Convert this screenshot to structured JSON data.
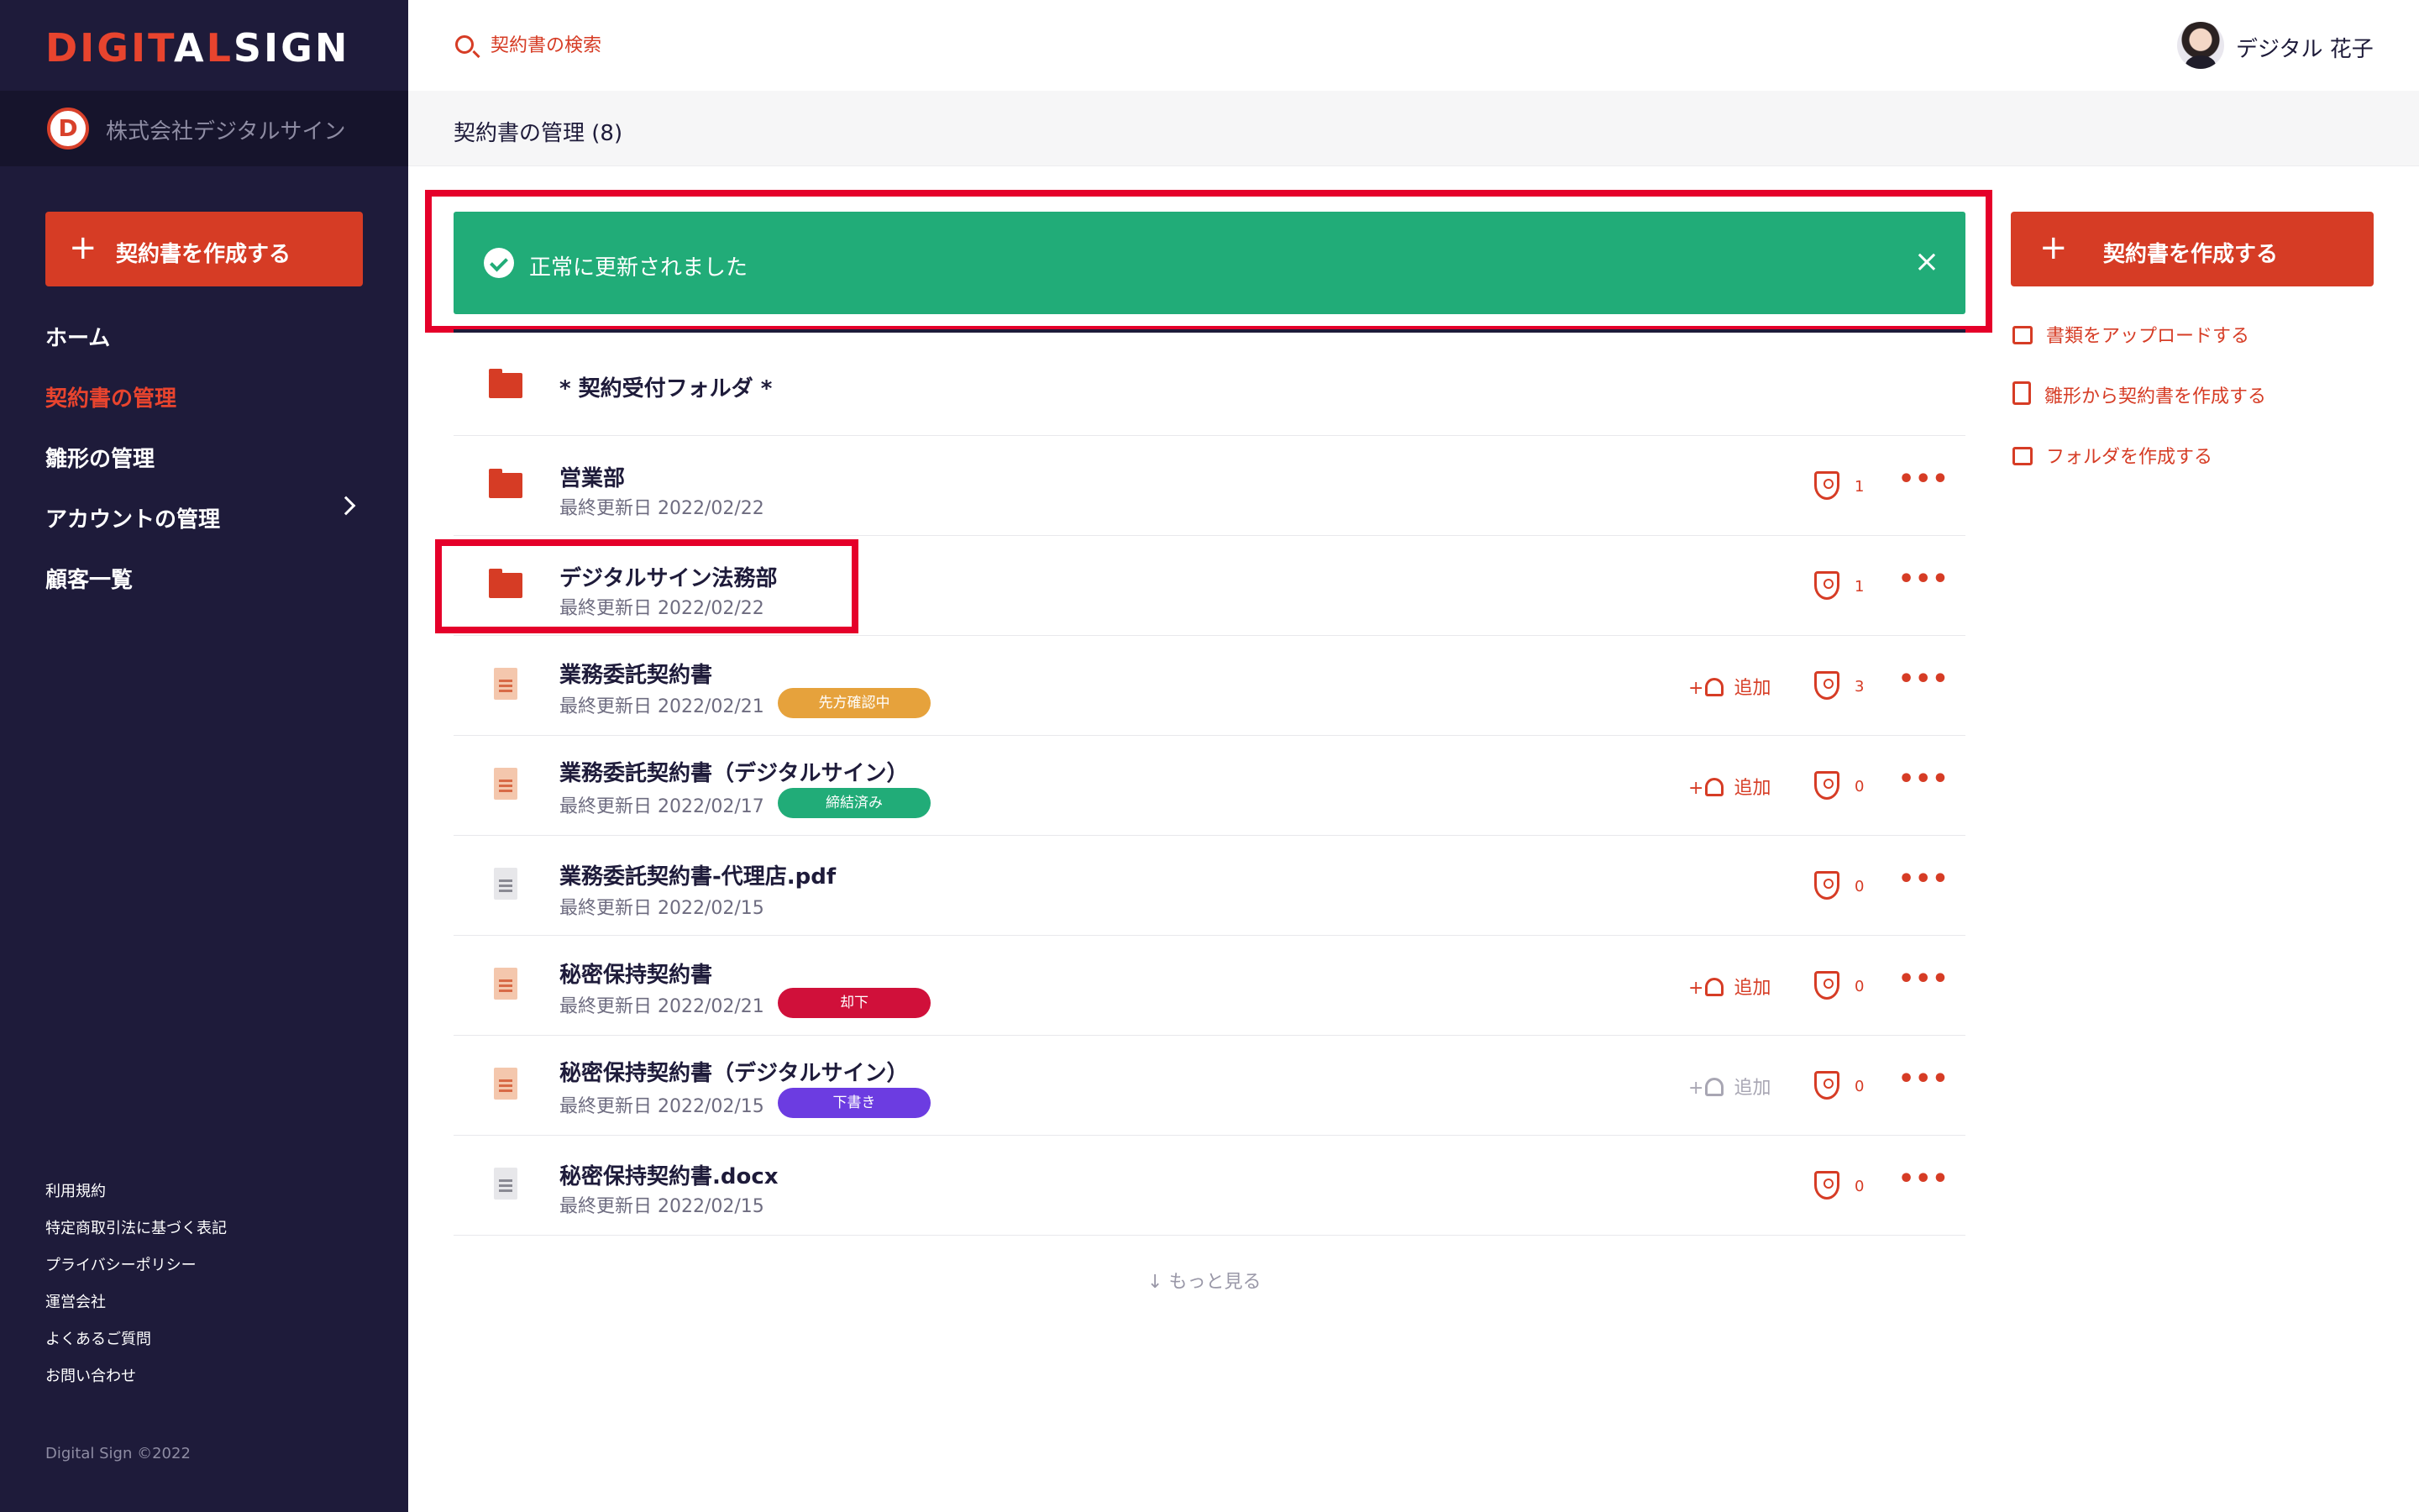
{
  "brand": {
    "logo_part1": "DIGIT",
    "logo_a": "A",
    "logo_part2": "L",
    "logo_part3": "SIGN",
    "accent_color": "#d63c25"
  },
  "company": {
    "badge": "D",
    "name": "株式会社デジタルサイン"
  },
  "sidebar": {
    "create_label": "契約書を作成する",
    "nav": [
      {
        "label": "ホーム"
      },
      {
        "label": "契約書の管理"
      },
      {
        "label": "雛形の管理"
      },
      {
        "label": "アカウントの管理"
      },
      {
        "label": "顧客一覧"
      }
    ],
    "footer_links": [
      {
        "label": "利用規約"
      },
      {
        "label": "特定商取引法に基づく表記"
      },
      {
        "label": "プライバシーポリシー"
      },
      {
        "label": "運営会社"
      },
      {
        "label": "よくあるご質問"
      },
      {
        "label": "お問い合わせ"
      }
    ],
    "copyright": "Digital Sign ©2022"
  },
  "header": {
    "search_placeholder": "契約書の検索",
    "user_name": "デジタル 花子"
  },
  "page": {
    "title": "契約書の管理 (8)"
  },
  "notification": {
    "message": "正常に更新されました",
    "close": "×",
    "color": "#21ac78"
  },
  "list": {
    "bell_label": "追加",
    "see_more": "もっと見る",
    "rows": [
      {
        "type": "folder",
        "title": "* 契約受付フォルダ *"
      },
      {
        "type": "folder",
        "title": "営業部",
        "date": "最終更新日 2022/02/22",
        "shield": "1"
      },
      {
        "type": "folder",
        "title": "デジタルサイン法務部",
        "date": "最終更新日 2022/02/22",
        "shield": "1"
      },
      {
        "type": "doc",
        "title": "業務委託契約書",
        "date": "最終更新日 2022/02/21",
        "badge": "先方確認中",
        "badge_color": "#e6a23c",
        "shield": "3"
      },
      {
        "type": "doc",
        "title": "業務委託契約書（デジタルサイン）",
        "date": "最終更新日 2022/02/17",
        "badge": "締結済み",
        "badge_color": "#21ac78",
        "shield": "0"
      },
      {
        "type": "file",
        "title": "業務委託契約書-代理店.pdf",
        "date": "最終更新日 2022/02/15",
        "shield": "0"
      },
      {
        "type": "doc",
        "title": "秘密保持契約書",
        "date": "最終更新日 2022/02/21",
        "badge": "却下",
        "badge_color": "#d0103a",
        "shield": "0"
      },
      {
        "type": "doc",
        "title": "秘密保持契約書（デジタルサイン）",
        "date": "最終更新日 2022/02/15",
        "badge": "下書き",
        "badge_color": "#6c3ce1",
        "shield": "0"
      },
      {
        "type": "file",
        "title": "秘密保持契約書.docx",
        "date": "最終更新日 2022/02/15",
        "shield": "0"
      }
    ]
  },
  "right_panel": {
    "create_label": "契約書を作成する",
    "actions": [
      {
        "label": "書類をアップロードする",
        "icon": "camera-icon"
      },
      {
        "label": "雛形から契約書を作成する",
        "icon": "template-icon"
      },
      {
        "label": "フォルダを作成する",
        "icon": "folder-icon"
      }
    ]
  }
}
